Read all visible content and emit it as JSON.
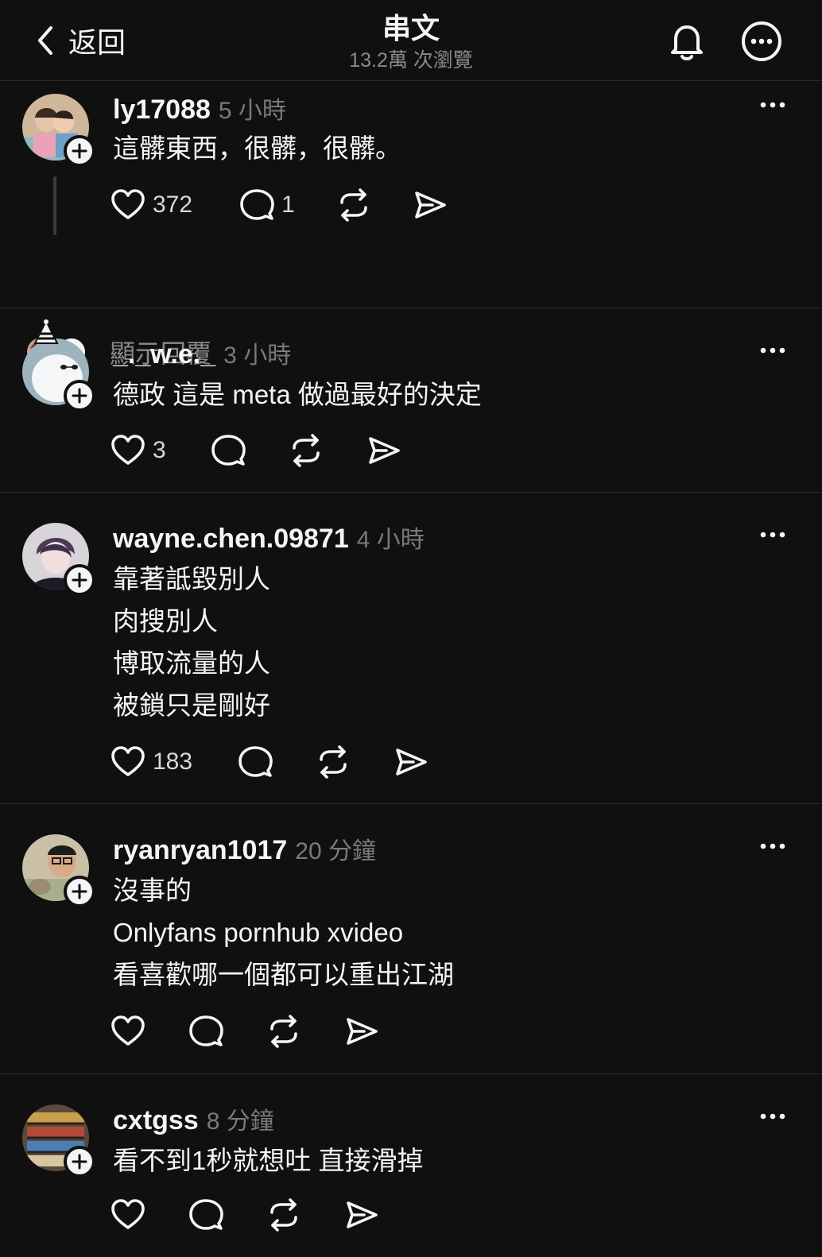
{
  "header": {
    "back_label": "返回",
    "title": "串文",
    "views": "13.2萬 次瀏覽"
  },
  "posts": [
    {
      "username": "ly17088",
      "time": "5 小時",
      "lines": [
        "這髒東西，很髒，很髒。"
      ],
      "likes": "372",
      "replies": "1",
      "show_replies": "顯示回覆"
    },
    {
      "username": "_._w.e._",
      "time": "3 小時",
      "lines": [
        "德政 這是 meta 做過最好的決定"
      ],
      "likes": "3",
      "replies": ""
    },
    {
      "username": "wayne.chen.09871",
      "time": "4 小時",
      "lines": [
        "靠著詆毀別人",
        "肉搜別人",
        "博取流量的人",
        "被鎖只是剛好"
      ],
      "likes": "183",
      "replies": ""
    },
    {
      "username": "ryanryan1017",
      "time": "20 分鐘",
      "lines": [
        "沒事的",
        "Onlyfans pornhub xvideo",
        "看喜歡哪一個都可以重出江湖"
      ],
      "likes": "",
      "replies": ""
    },
    {
      "username": "cxtgss",
      "time": "8 分鐘",
      "lines": [
        "看不到1秒就想吐 直接滑掉"
      ],
      "likes": "",
      "replies": ""
    }
  ],
  "colors": {
    "background": "#101010",
    "text": "#f3f5f7",
    "muted": "#7a7a7a",
    "divider": "#2a2a2a"
  }
}
